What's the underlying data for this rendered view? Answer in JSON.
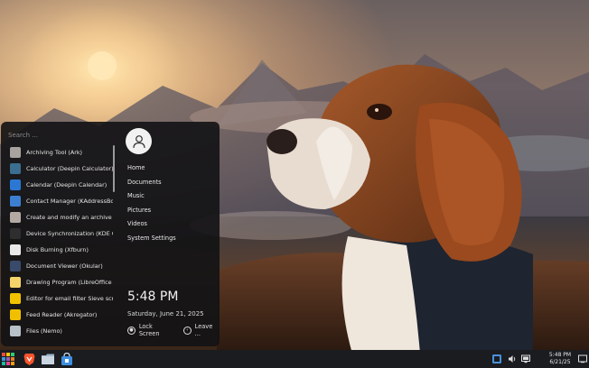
{
  "menu": {
    "search_placeholder": "Search ...",
    "apps": [
      {
        "label": "Archiving Tool (Ark)",
        "icon": "archive-icon",
        "color": "#a9a3a0"
      },
      {
        "label": "Calculator (Deepin Calculator)",
        "icon": "calculator-icon",
        "color": "#3b6e8f"
      },
      {
        "label": "Calendar (Deepin Calendar)",
        "icon": "calendar-icon",
        "color": "#2b78d4"
      },
      {
        "label": "Contact Manager (KAddressBo...",
        "icon": "contacts-icon",
        "color": "#3c7fd0"
      },
      {
        "label": "Create and modify an archive (...",
        "icon": "archive-create-icon",
        "color": "#b3aaa4"
      },
      {
        "label": "Device Synchronization (KDE C...",
        "icon": "kdeconnect-icon",
        "color": "#2e2e2e"
      },
      {
        "label": "Disk Burning (Xfburn)",
        "icon": "disc-icon",
        "color": "#e9e9e9"
      },
      {
        "label": "Document Viewer (Okular)",
        "icon": "okular-icon",
        "color": "#3a4a6a"
      },
      {
        "label": "Drawing Program (LibreOffice ...",
        "icon": "draw-icon",
        "color": "#f4d36a"
      },
      {
        "label": "Editor for email filter Sieve scri...",
        "icon": "sieve-editor-icon",
        "color": "#f2c200"
      },
      {
        "label": "Feed Reader (Akregator)",
        "icon": "feed-reader-icon",
        "color": "#f0c000"
      },
      {
        "label": "Files (Nemo)",
        "icon": "folder-icon",
        "color": "#b8c0c8"
      }
    ],
    "places": [
      "Home",
      "Documents",
      "Music",
      "Pictures",
      "Videos",
      "System Settings"
    ],
    "time": "5:48 PM",
    "date": "Saturday, June 21, 2025",
    "lock_label": "Lock Screen",
    "leave_label": "Leave ..."
  },
  "taskbar": {
    "time": "5:48 PM",
    "date": "6/21/25",
    "pinned": [
      "app-launcher-icon",
      "brave-browser-icon",
      "file-manager-icon",
      "software-store-icon"
    ],
    "tray": [
      "app-indicator-icon",
      "volume-icon",
      "display-icon",
      "notifications-icon"
    ]
  }
}
